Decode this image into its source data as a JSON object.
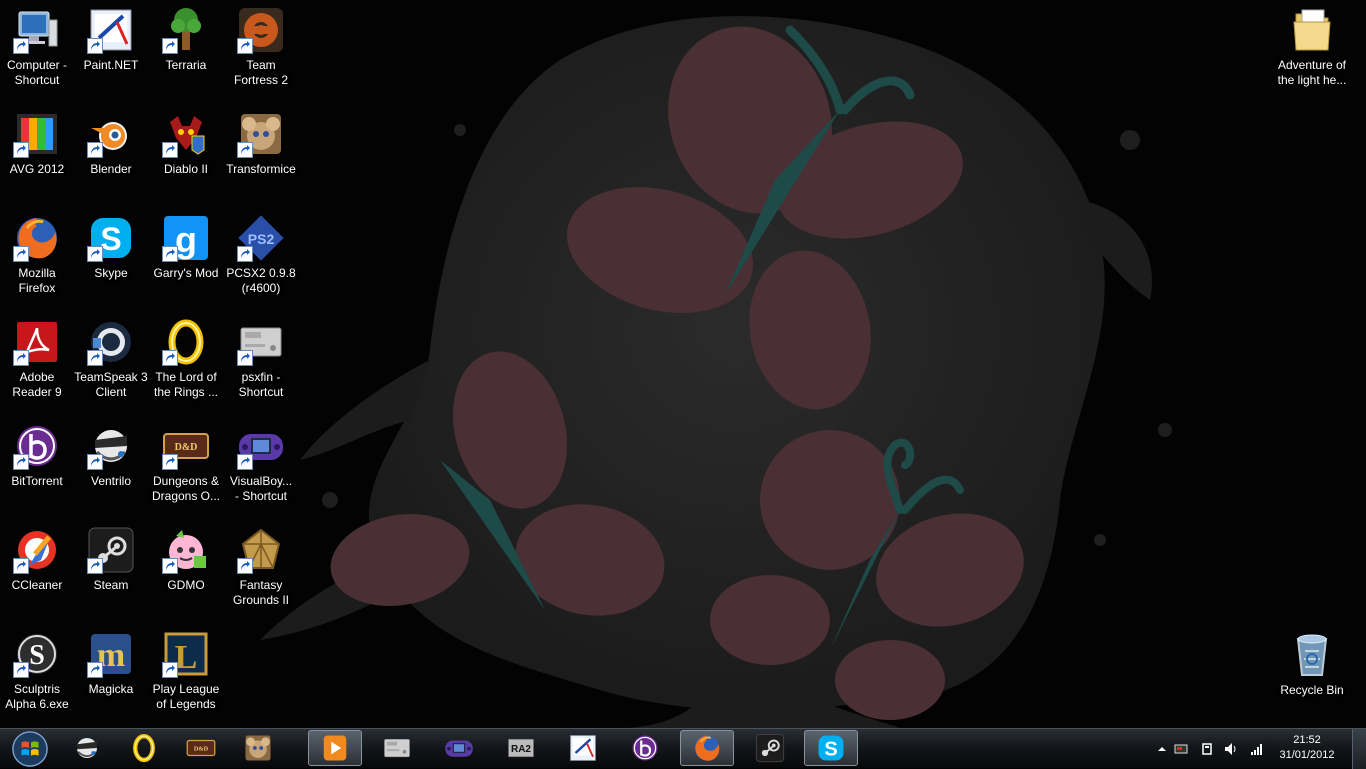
{
  "desktop": {
    "icons": [
      {
        "label": "Computer -\nShortcut",
        "icon": "computer-icon",
        "shortcut": true
      },
      {
        "label": "Paint.NET",
        "icon": "paintnet-icon",
        "shortcut": true
      },
      {
        "label": "Terraria",
        "icon": "terraria-icon",
        "shortcut": true
      },
      {
        "label": "Team\nFortress 2",
        "icon": "tf2-icon",
        "shortcut": true
      },
      {
        "label": "AVG 2012",
        "icon": "avg-icon",
        "shortcut": true
      },
      {
        "label": "Blender",
        "icon": "blender-icon",
        "shortcut": true
      },
      {
        "label": "Diablo II",
        "icon": "diablo-icon",
        "shortcut": true
      },
      {
        "label": "Transformice",
        "icon": "transformice-icon",
        "shortcut": true
      },
      {
        "label": "Mozilla\nFirefox",
        "icon": "firefox-icon",
        "shortcut": true
      },
      {
        "label": "Skype",
        "icon": "skype-icon",
        "shortcut": true
      },
      {
        "label": "Garry's Mod",
        "icon": "gmod-icon",
        "shortcut": true
      },
      {
        "label": "PCSX2 0.9.8\n(r4600)",
        "icon": "pcsx2-icon",
        "shortcut": true
      },
      {
        "label": "Adobe\nReader 9",
        "icon": "adobe-reader-icon",
        "shortcut": true
      },
      {
        "label": "TeamSpeak 3\nClient",
        "icon": "teamspeak-icon",
        "shortcut": true
      },
      {
        "label": "The Lord of\nthe Rings ...",
        "icon": "ring-icon",
        "shortcut": true
      },
      {
        "label": "psxfin -\nShortcut",
        "icon": "playstation-icon",
        "shortcut": true
      },
      {
        "label": "BitTorrent",
        "icon": "bittorrent-icon",
        "shortcut": true
      },
      {
        "label": "Ventrilo",
        "icon": "ventrilo-icon",
        "shortcut": true
      },
      {
        "label": "Dungeons &\nDragons O...",
        "icon": "ddo-icon",
        "shortcut": true
      },
      {
        "label": "VisualBoy...\n- Shortcut",
        "icon": "gameboy-advance-icon",
        "shortcut": true
      },
      {
        "label": "CCleaner",
        "icon": "ccleaner-icon",
        "shortcut": true
      },
      {
        "label": "Steam",
        "icon": "steam-icon",
        "shortcut": true
      },
      {
        "label": "GDMO",
        "icon": "gdmo-icon",
        "shortcut": true
      },
      {
        "label": "Fantasy\nGrounds II",
        "icon": "fantasy-grounds-icon",
        "shortcut": true
      },
      {
        "label": "Sculptris\nAlpha 6.exe",
        "icon": "sculptris-icon",
        "shortcut": true
      },
      {
        "label": "Magicka",
        "icon": "magicka-icon",
        "shortcut": true
      },
      {
        "label": "Play League\nof Legends",
        "icon": "league-icon",
        "shortcut": true
      }
    ],
    "right_icons": [
      {
        "label": "Adventure of\nthe light he...",
        "icon": "folder-icon"
      },
      {
        "label": "Recycle Bin",
        "icon": "recycle-bin-icon"
      }
    ]
  },
  "taskbar": {
    "start_icon": "windows-start-icon",
    "items": [
      {
        "icon": "ventrilo-icon",
        "active": false
      },
      {
        "icon": "ring-icon",
        "active": false
      },
      {
        "icon": "ddo-icon",
        "active": false
      },
      {
        "icon": "transformice-icon",
        "active": false
      },
      {
        "icon": "media-player-icon",
        "active": true
      },
      {
        "icon": "playstation-icon",
        "active": false
      },
      {
        "icon": "gameboy-advance-icon",
        "active": false
      },
      {
        "icon": "ra2-icon",
        "active": false,
        "text": "RA2"
      },
      {
        "icon": "paintnet-icon",
        "active": false
      },
      {
        "icon": "bittorrent-icon",
        "active": false
      },
      {
        "icon": "firefox-icon",
        "active": true
      },
      {
        "icon": "steam-icon",
        "active": false
      },
      {
        "icon": "skype-icon",
        "active": true
      }
    ],
    "tray": {
      "time": "21:52",
      "date": "31/01/2012"
    }
  }
}
